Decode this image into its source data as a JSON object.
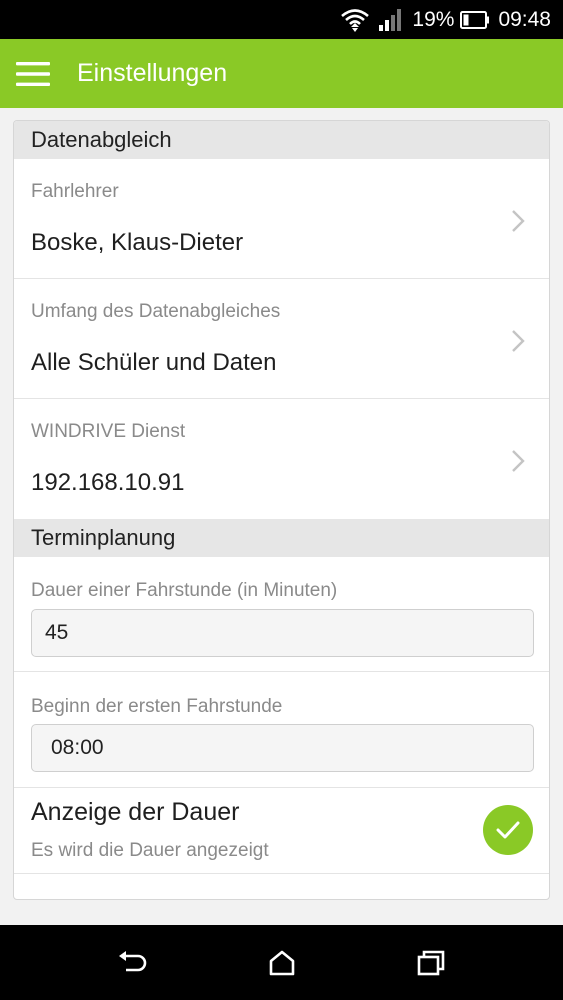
{
  "status_bar": {
    "battery_percent": "19%",
    "time": "09:48",
    "icons": [
      "wifi-icon",
      "signal-icon",
      "battery-icon"
    ]
  },
  "app_bar": {
    "title": "Einstellungen",
    "menu_icon": "hamburger-menu-icon",
    "color": "#8ac926"
  },
  "sections": {
    "sync": {
      "header": "Datenabgleich",
      "rows": [
        {
          "label": "Fahrlehrer",
          "value": "Boske, Klaus-Dieter"
        },
        {
          "label": "Umfang des Datenabgleiches",
          "value": "Alle Schüler und Daten"
        },
        {
          "label": "WINDRIVE Dienst",
          "value": "192.168.10.91"
        }
      ]
    },
    "scheduling": {
      "header": "Terminplanung",
      "duration": {
        "label": "Dauer einer Fahrstunde (in Minuten)",
        "value": "45"
      },
      "start": {
        "label": "Beginn der ersten Fahrstunde",
        "value": "08:00"
      },
      "show_duration": {
        "title": "Anzeige der Dauer",
        "subtitle": "Es wird die Dauer angezeigt",
        "checked": true
      }
    }
  },
  "nav_bar": {
    "icons": [
      "back-icon",
      "home-icon",
      "recent-apps-icon"
    ]
  }
}
